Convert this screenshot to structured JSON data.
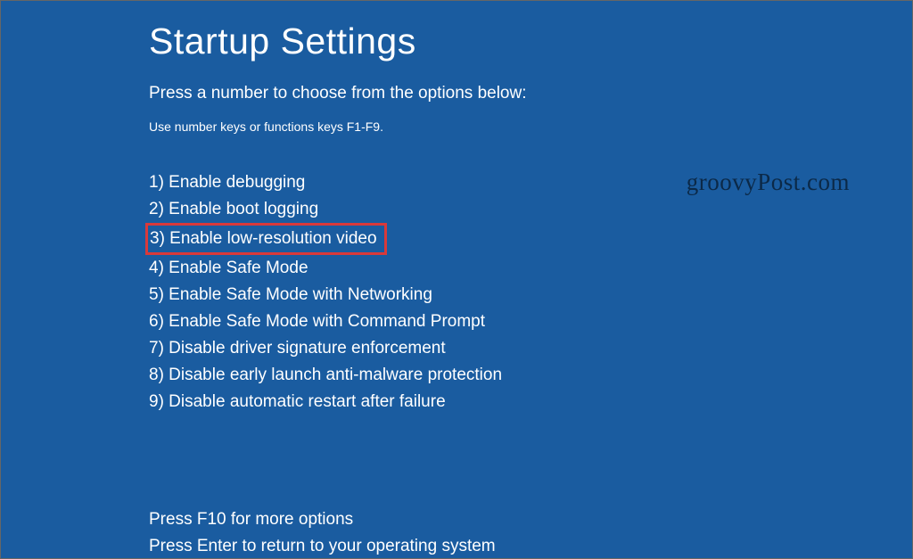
{
  "title": "Startup Settings",
  "subtitle": "Press a number to choose from the options below:",
  "hint": "Use number keys or functions keys F1-F9.",
  "options": [
    {
      "label": "1) Enable debugging",
      "highlighted": false
    },
    {
      "label": "2) Enable boot logging",
      "highlighted": false
    },
    {
      "label": "3) Enable low-resolution video",
      "highlighted": true
    },
    {
      "label": "4) Enable Safe Mode",
      "highlighted": false
    },
    {
      "label": "5) Enable Safe Mode with Networking",
      "highlighted": false
    },
    {
      "label": "6) Enable Safe Mode with Command Prompt",
      "highlighted": false
    },
    {
      "label": "7) Disable driver signature enforcement",
      "highlighted": false
    },
    {
      "label": "8) Disable early launch anti-malware protection",
      "highlighted": false
    },
    {
      "label": "9) Disable automatic restart after failure",
      "highlighted": false
    }
  ],
  "footer": {
    "more_options": "Press F10 for more options",
    "return_text": "Press Enter to return to your operating system"
  },
  "watermark": "groovyPost.com",
  "colors": {
    "background": "#1a5ca0",
    "text": "#ffffff",
    "highlight_border": "#d9393a"
  }
}
